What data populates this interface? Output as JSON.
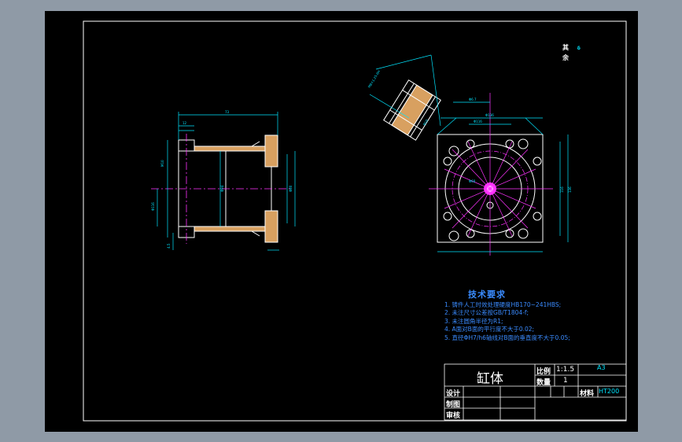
{
  "colors": {
    "background": "#8f9aa6",
    "sheet": "#000000",
    "outline": "#ffffff",
    "dimension": "#00e5ff",
    "centerline": "#ff33ff",
    "note": "#3a8bff",
    "part_fill": "#d8a060"
  },
  "corner": {
    "line1": "其",
    "line1b": "δ",
    "line2": "余"
  },
  "tech_requirements": {
    "title": "技术要求",
    "items": [
      "1. 铸件人工时效处理硬度HB170~241HBS;",
      "2. 未注尺寸公差按GB/T1804-f;",
      "3. 未注圆角半径为R1;",
      "4. A面对B面的平行度不大于0.02;",
      "5. 直径ΦH7/h6轴线对B面的垂直度不大于0.05;"
    ]
  },
  "title_block": {
    "part_name": "缸体",
    "scale_label": "比例",
    "scale_value": "1:1.5",
    "qty_label": "数量",
    "qty_value": "1",
    "sheet_size": "A3",
    "material_label": "材料",
    "material_value": "HT200",
    "design_label": "设计",
    "draw_label": "制图",
    "review_label": "审核"
  }
}
